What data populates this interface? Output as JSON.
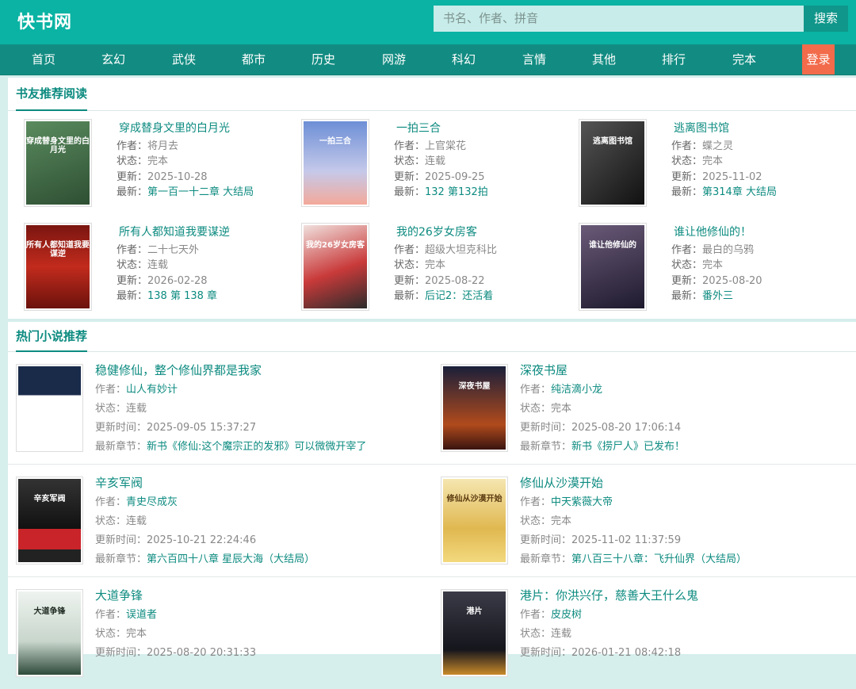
{
  "site": {
    "logo": "快书网"
  },
  "search": {
    "placeholder": "书名、作者、拼音",
    "button": "搜索"
  },
  "nav": {
    "items": [
      "首页",
      "玄幻",
      "武侠",
      "都市",
      "历史",
      "网游",
      "科幻",
      "言情",
      "其他",
      "排行",
      "完本"
    ],
    "login": "登录"
  },
  "labels": {
    "author": "作者：",
    "status": "状态：",
    "updated": "更新：",
    "latest": "最新：",
    "update_time": "更新时间：",
    "latest_chapter": "最新章节："
  },
  "recommend": {
    "title": "书友推荐阅读",
    "books": [
      {
        "title": "穿成替身文里的白月光",
        "author": "将月去",
        "status": "完本",
        "updated": "2025-10-28",
        "latest": "第一百一十二章 大结局",
        "cover_color": "#3f6b45",
        "cover_text": "穿成替身文里的白月光"
      },
      {
        "title": "一拍三合",
        "author": "上官棠花",
        "status": "连载",
        "updated": "2025-09-25",
        "latest": "132 第132拍",
        "cover_color": "#8aa7d9",
        "cover_text": "一拍三合"
      },
      {
        "title": "逃离图书馆",
        "author": "蝶之灵",
        "status": "完本",
        "updated": "2025-11-02",
        "latest": "第314章 大结局",
        "cover_color": "#2a2a2a",
        "cover_text": "逃离图书馆"
      },
      {
        "title": "所有人都知道我要谋逆",
        "author": "二十七天外",
        "status": "连载",
        "updated": "2026-02-28",
        "latest": "138 第 138 章",
        "cover_color": "#a8201a",
        "cover_text": "所有人都知道我要谋逆"
      },
      {
        "title": "我的26岁女房客",
        "author": "超级大坦克科比",
        "status": "完本",
        "updated": "2025-08-22",
        "latest": "后记2：还活着",
        "cover_color": "#d33b3b",
        "cover_text": "我的26岁女房客"
      },
      {
        "title": "谁让他修仙的！",
        "author": "最白的乌鸦",
        "status": "完本",
        "updated": "2025-08-20",
        "latest": "番外三",
        "cover_color": "#3a2f4a",
        "cover_text": "谁让他修仙的"
      }
    ]
  },
  "hot": {
    "title": "热门小说推荐",
    "books": [
      {
        "title": "稳健修仙，整个修仙界都是我家",
        "author": "山人有妙计",
        "status": "连载",
        "updated": "2025-09-05 15:37:27",
        "latest": "新书《修仙:这个魔宗正的发邪》可以微微开宰了",
        "cover_color": "#1a2b4a",
        "cover_text": ""
      },
      {
        "title": "深夜书屋",
        "author": "纯洁滴小龙",
        "status": "完本",
        "updated": "2025-08-20 17:06:14",
        "latest": "新书《捞尸人》已发布！",
        "cover_color": "#3b1d14",
        "cover_text": "深夜书屋"
      },
      {
        "title": "辛亥军阀",
        "author": "青史尽成灰",
        "status": "连载",
        "updated": "2025-10-21 22:24:46",
        "latest": "第六百四十八章 星辰大海（大结局）",
        "cover_color": "#2b2b2b",
        "cover_text": "辛亥军阀"
      },
      {
        "title": "修仙从沙漠开始",
        "author": "中天紫薇大帝",
        "status": "完本",
        "updated": "2025-11-02 11:37:59",
        "latest": "第八百三十八章：飞升仙界（大结局）",
        "cover_color": "#d9b84a",
        "cover_text": "修仙从沙漠开始"
      },
      {
        "title": "大道争锋",
        "author": "误道者",
        "status": "完本",
        "updated": "2025-08-20 20:31:33",
        "latest": "",
        "cover_color": "#e4ece6",
        "cover_text": "大道争锋"
      },
      {
        "title": "港片：你洪兴仔，慈善大王什么鬼",
        "author": "皮皮树",
        "status": "连载",
        "updated": "2026-01-21 08:42:18",
        "latest": "",
        "cover_color": "#2a2a35",
        "cover_text": "港片"
      }
    ]
  }
}
